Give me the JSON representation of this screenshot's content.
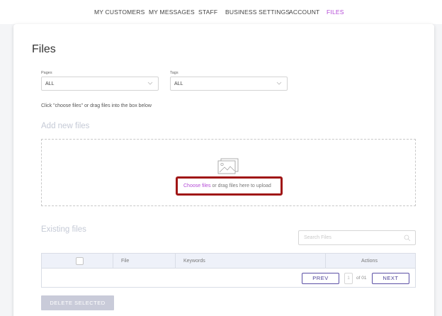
{
  "nav": {
    "items": [
      {
        "label": "MY CUSTOMERS"
      },
      {
        "label": "MY MESSAGES"
      },
      {
        "label": "STAFF"
      },
      {
        "label": "BUSINESS SETTINGS"
      },
      {
        "label": "ACCOUNT"
      },
      {
        "label": "FILES",
        "active": true
      }
    ]
  },
  "page": {
    "title": "Files"
  },
  "filters": {
    "pages": {
      "label": "Pages",
      "value": "ALL"
    },
    "tags": {
      "label": "Tags",
      "value": "ALL"
    }
  },
  "hint": "Click \"choose files\" or drag files into the box below",
  "add_section": {
    "title": "Add new files",
    "choose_link": "Choose files",
    "upload_text": " or drag files here to upload",
    "icon": "image-icon"
  },
  "existing_section": {
    "title": "Existing files",
    "search_placeholder": "Search Files"
  },
  "table": {
    "columns": [
      "File",
      "Keywords",
      "Actions"
    ],
    "pagination": {
      "prev": "PREV",
      "page": "1",
      "of": "of 01",
      "next": "NEXT"
    }
  },
  "delete_button": "DELETE SELECTED",
  "colors": {
    "accent": "#b44bd6",
    "highlight": "#a01616",
    "pager": "#4a3f96"
  }
}
